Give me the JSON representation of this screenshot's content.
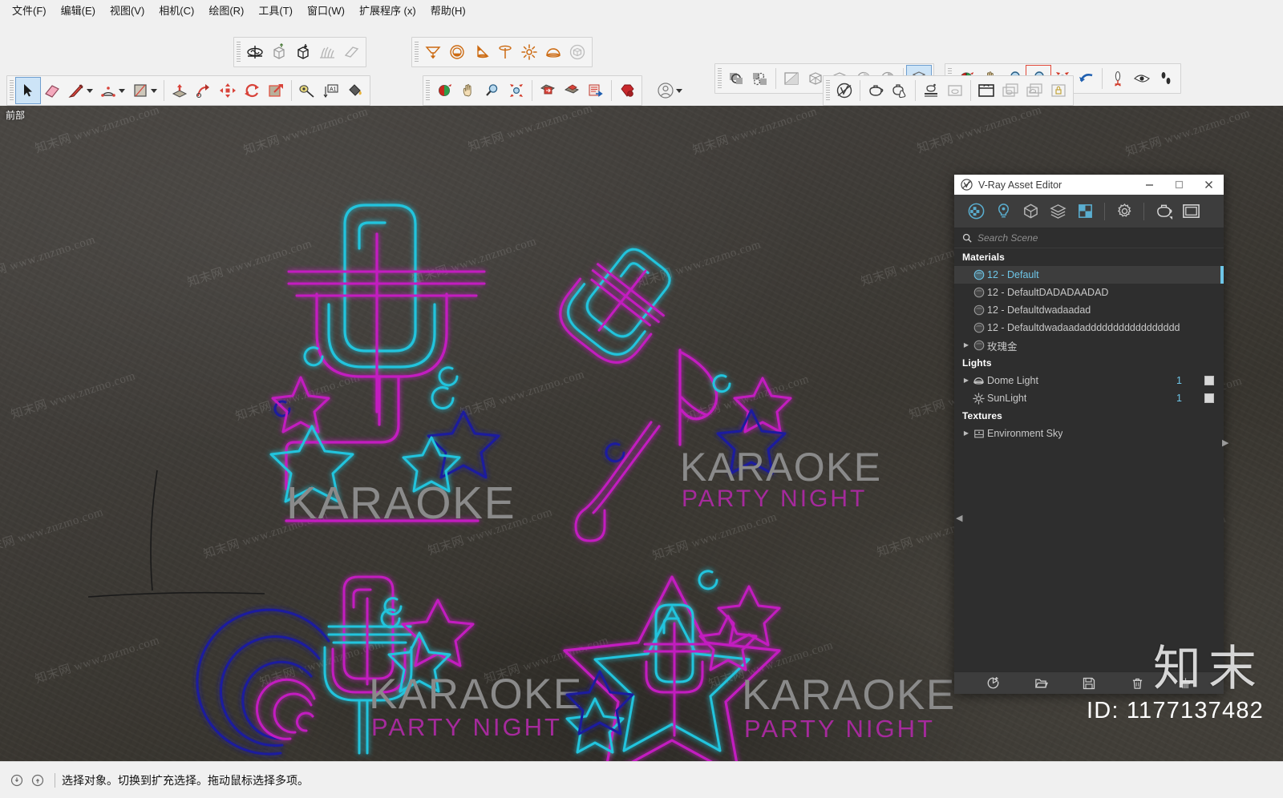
{
  "menu": {
    "items": [
      {
        "label": "文件(F)",
        "name": "menu-file"
      },
      {
        "label": "编辑(E)",
        "name": "menu-edit"
      },
      {
        "label": "视图(V)",
        "name": "menu-view"
      },
      {
        "label": "相机(C)",
        "name": "menu-camera"
      },
      {
        "label": "绘图(R)",
        "name": "menu-draw"
      },
      {
        "label": "工具(T)",
        "name": "menu-tools"
      },
      {
        "label": "窗口(W)",
        "name": "menu-window"
      },
      {
        "label": "扩展程序 (x)",
        "name": "menu-extensions"
      },
      {
        "label": "帮助(H)",
        "name": "menu-help"
      }
    ]
  },
  "viewport": {
    "view_label": "前部",
    "background_color": "#3c3a36",
    "watermark_text": "知末网 www.znzmo.com",
    "neon": {
      "cyan": "#20c4dd",
      "magenta": "#c31fc0",
      "blue": "#1a1a9e",
      "text_gray": "#8a8a8a",
      "text_magenta": "#a52a9c",
      "logos": [
        {
          "title": "KARAOKE",
          "subtitle": ""
        },
        {
          "title": "KARAOKE",
          "subtitle": "PARTY NIGHT"
        },
        {
          "title": "KARAOKE",
          "subtitle": "PARTY NIGHT"
        },
        {
          "title": "KARAOKE",
          "subtitle": "PARTY NIGHT"
        }
      ]
    }
  },
  "vray": {
    "title": "V-Ray Asset Editor",
    "window_buttons": [
      {
        "name": "minimize-button",
        "glyph": "minimize"
      },
      {
        "name": "maximize-button",
        "glyph": "maximize"
      },
      {
        "name": "close-button",
        "glyph": "close"
      }
    ],
    "toolbar": [
      {
        "name": "materials-tab",
        "icon": "sphere-checker-icon",
        "active": true
      },
      {
        "name": "lights-tab",
        "icon": "light-bulb-icon",
        "active": true
      },
      {
        "name": "geometry-tab",
        "icon": "cube-icon",
        "active": false
      },
      {
        "name": "render-elements-tab",
        "icon": "layers-icon",
        "active": false
      },
      {
        "name": "textures-tab",
        "icon": "texture-square-icon",
        "active": true
      },
      {
        "name": "settings-tab",
        "icon": "gear-icon",
        "active": false
      },
      {
        "name": "render-button",
        "icon": "teapot-icon",
        "active": false
      },
      {
        "name": "frame-buffer-button",
        "icon": "frame-buffer-icon",
        "active": false
      }
    ],
    "search": {
      "placeholder": "Search Scene",
      "value": "",
      "icon": "search-icon"
    },
    "groups": [
      {
        "header": "Materials",
        "name": "group-materials",
        "items": [
          {
            "label": "12 - Default",
            "icon": "material-sphere-icon",
            "selected": true,
            "expandable": false,
            "count": "",
            "checkbox": false
          },
          {
            "label": "12 - DefaultDADADAADAD",
            "icon": "material-sphere-icon",
            "selected": false,
            "expandable": false,
            "count": "",
            "checkbox": false
          },
          {
            "label": "12 - Defaultdwadaadad",
            "icon": "material-sphere-icon",
            "selected": false,
            "expandable": false,
            "count": "",
            "checkbox": false
          },
          {
            "label": "12 - Defaultdwadaadaddddddddddddddddd",
            "icon": "material-sphere-icon",
            "selected": false,
            "expandable": false,
            "count": "",
            "checkbox": false
          },
          {
            "label": "玫瑰金",
            "icon": "material-sphere-icon",
            "selected": false,
            "expandable": true,
            "count": "",
            "checkbox": false
          }
        ]
      },
      {
        "header": "Lights",
        "name": "group-lights",
        "items": [
          {
            "label": "Dome Light",
            "icon": "dome-light-icon",
            "selected": false,
            "expandable": true,
            "count": "1",
            "checkbox": true
          },
          {
            "label": "SunLight",
            "icon": "sun-light-icon",
            "selected": false,
            "expandable": false,
            "count": "1",
            "checkbox": true
          }
        ]
      },
      {
        "header": "Textures",
        "name": "group-textures",
        "items": [
          {
            "label": "Environment Sky",
            "icon": "texture-bitmap-icon",
            "selected": false,
            "expandable": true,
            "count": "",
            "checkbox": false
          }
        ]
      }
    ],
    "bottom_buttons": [
      {
        "name": "add-asset-button",
        "icon": "add-asset-icon"
      },
      {
        "name": "open-asset-button",
        "icon": "folder-open-icon"
      },
      {
        "name": "save-asset-button",
        "icon": "save-disk-icon"
      },
      {
        "name": "delete-asset-button",
        "icon": "trash-icon"
      },
      {
        "name": "purge-asset-button",
        "icon": "purge-icon"
      }
    ],
    "collapse_left": "◀",
    "collapse_right": "▶"
  },
  "watermark": {
    "brand_cn": "知末",
    "id_label": "ID: 1177137482"
  },
  "statusbar": {
    "message": "选择对象。切换到扩充选择。拖动鼠标选择多项。",
    "icons": [
      {
        "name": "info-context-icon"
      },
      {
        "name": "info-detail-icon"
      }
    ]
  }
}
